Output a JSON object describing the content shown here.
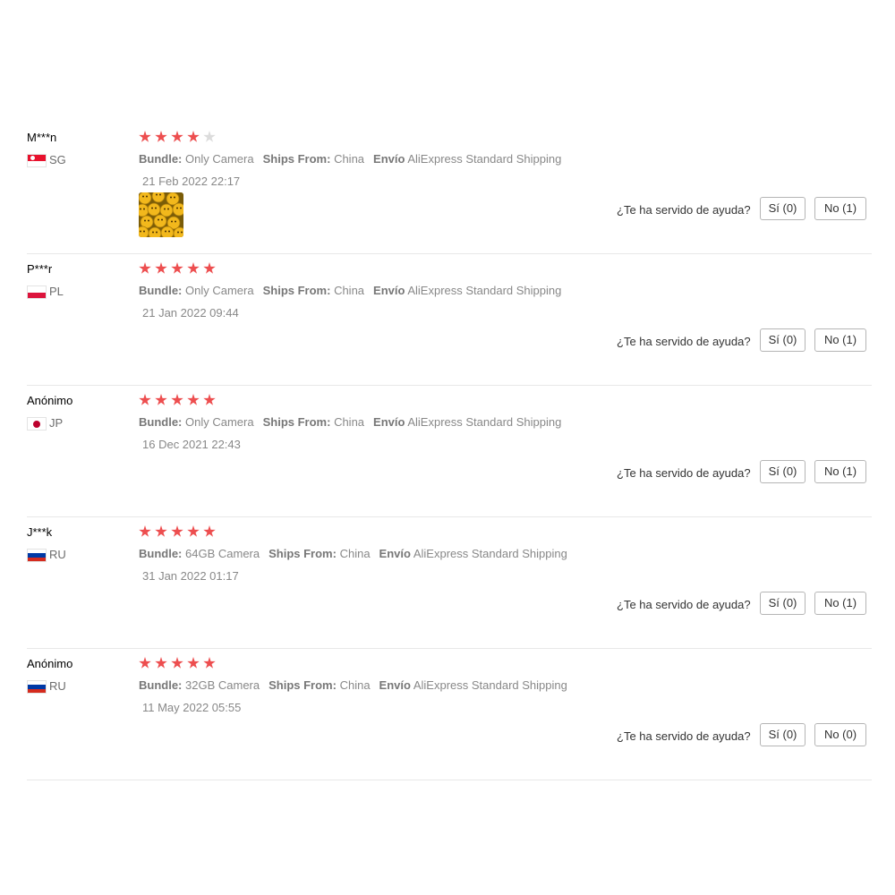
{
  "helpful_question": "¿Te ha servido de ayuda?",
  "labels": {
    "bundle": "Bundle:",
    "ships_from": "Ships From:",
    "shipping": "Envío"
  },
  "colors": {
    "star_on": "#ed4e4f",
    "star_off": "#dcdcdc"
  },
  "reviews": [
    {
      "user": "M***n",
      "country": "SG",
      "flag": "flag-sg-icon",
      "rating": 4,
      "bundle": "Only Camera",
      "ships_from": "China",
      "shipping": "AliExpress Standard Shipping",
      "date": "21 Feb 2022 22:17",
      "has_photo": true,
      "yes_label": "Sí (0)",
      "no_label": "No (1)"
    },
    {
      "user": "P***r",
      "country": "PL",
      "flag": "flag-pl-icon",
      "rating": 5,
      "bundle": "Only Camera",
      "ships_from": "China",
      "shipping": "AliExpress Standard Shipping",
      "date": "21 Jan 2022 09:44",
      "has_photo": false,
      "yes_label": "Sí (0)",
      "no_label": "No (1)"
    },
    {
      "user": "Anónimo",
      "country": "JP",
      "flag": "flag-jp-icon",
      "rating": 5,
      "bundle": "Only Camera",
      "ships_from": "China",
      "shipping": "AliExpress Standard Shipping",
      "date": "16 Dec 2021 22:43",
      "has_photo": false,
      "yes_label": "Sí (0)",
      "no_label": "No (1)"
    },
    {
      "user": "J***k",
      "country": "RU",
      "flag": "flag-ru-icon",
      "rating": 5,
      "bundle": "64GB Camera",
      "ships_from": "China",
      "shipping": "AliExpress Standard Shipping",
      "date": "31 Jan 2022 01:17",
      "has_photo": false,
      "yes_label": "Sí (0)",
      "no_label": "No (1)"
    },
    {
      "user": "Anónimo",
      "country": "RU",
      "flag": "flag-ru-icon",
      "rating": 5,
      "bundle": "32GB Camera",
      "ships_from": "China",
      "shipping": "AliExpress Standard Shipping",
      "date": "11 May 2022 05:55",
      "has_photo": false,
      "yes_label": "Sí (0)",
      "no_label": "No (0)"
    }
  ]
}
